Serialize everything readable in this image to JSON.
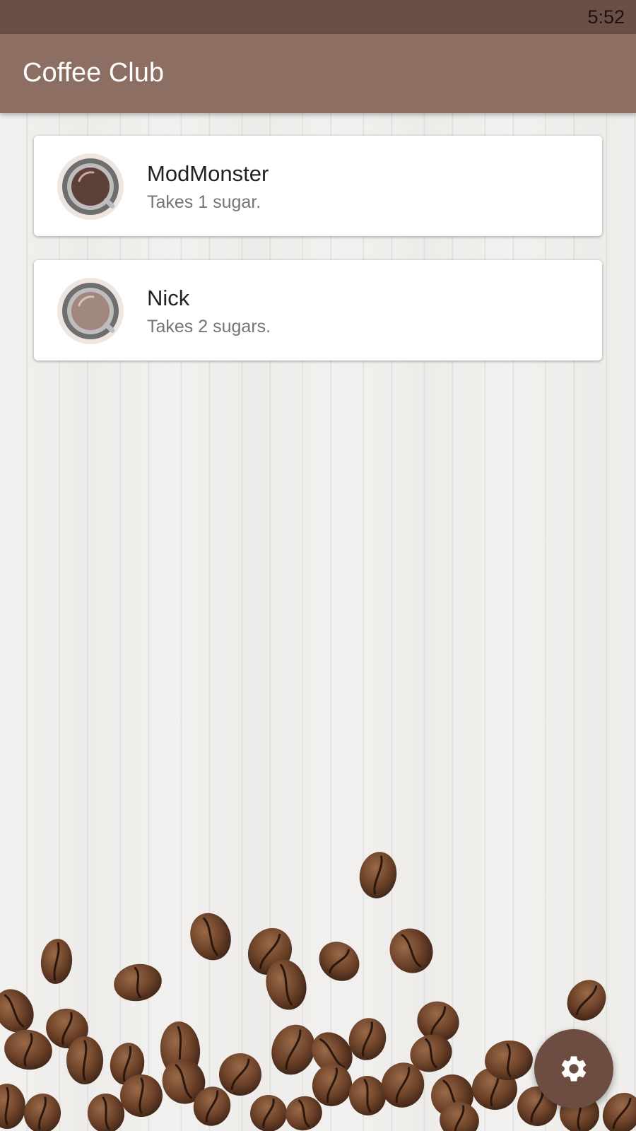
{
  "status_bar": {
    "time": "5:52"
  },
  "app_bar": {
    "title": "Coffee Club"
  },
  "members": [
    {
      "name": "ModMonster",
      "subtitle": "Takes 1 sugar.",
      "coffee_color": "#5d4037"
    },
    {
      "name": "Nick",
      "subtitle": "Takes 2 sugars.",
      "coffee_color": "#a1887f"
    }
  ],
  "fab": {
    "icon": "gear-icon"
  },
  "colors": {
    "status_bar": "#6a4f47",
    "app_bar": "#8d6e63",
    "fab": "#6d4c41"
  }
}
